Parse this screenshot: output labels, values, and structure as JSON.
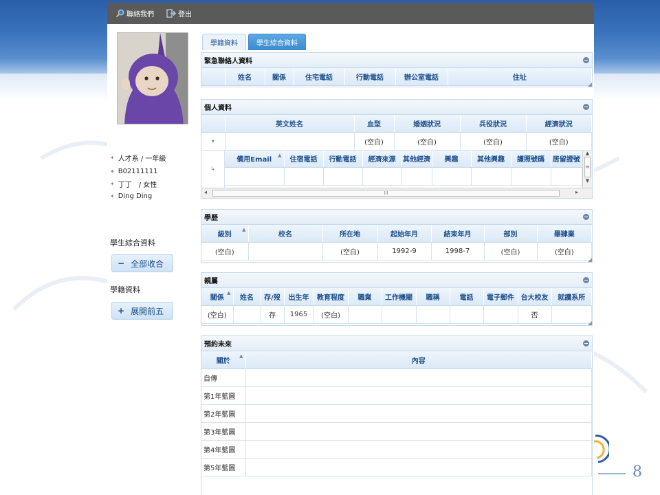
{
  "slide": {
    "page_number": "8"
  },
  "toolbar": {
    "items": [
      {
        "label": "聯絡我們",
        "icon": "search-icon"
      },
      {
        "label": "登出",
        "icon": "logout-icon"
      }
    ]
  },
  "profile": {
    "dept_year": "人才系 / 一年級",
    "student_id": "B02111111",
    "name_gender": "丁丁　/ 女性",
    "english_name": "Ding Ding"
  },
  "sidebar": {
    "summary_heading": "學生綜合資料",
    "collapse_all_label": "全部收合",
    "registry_heading": "學籍資料",
    "expand_top_five_label": "展開前五"
  },
  "tabs": [
    {
      "label": "學籍資料",
      "active": false
    },
    {
      "label": "學生綜合資料",
      "active": true
    }
  ],
  "emergency": {
    "title": "緊急聯絡人資料",
    "columns": [
      "姓名",
      "關係",
      "住宅電話",
      "行動電話",
      "辦公室電話",
      "住址"
    ]
  },
  "personal": {
    "title": "個人資料",
    "columns": [
      "英文姓名",
      "血型",
      "婚姻狀況",
      "兵役狀況",
      "經濟狀況"
    ],
    "row": [
      "",
      "(空白)",
      "(空白)",
      "(空白)",
      "(空白)"
    ],
    "sub_columns": [
      "備用Email",
      "住宿電話",
      "行動電話",
      "經濟來源",
      "其他經濟",
      "興趣",
      "其他興趣",
      "護照號碼",
      "居留證號"
    ],
    "scroll_thumb_glyph": "≡",
    "hscroll_glyph": "III"
  },
  "education": {
    "title": "學歷",
    "columns": [
      "級別",
      "校名",
      "所在地",
      "起始年月",
      "結束年月",
      "部別",
      "畢肄業"
    ],
    "rows": [
      [
        "(空白)",
        "",
        "(空白)",
        "1992-9",
        "1998-7",
        "(空白)",
        "(空白)"
      ]
    ]
  },
  "family": {
    "title": "親屬",
    "columns": [
      "關係",
      "姓名",
      "存/歿",
      "出生年",
      "教育程度",
      "職業",
      "工作機關",
      "職稱",
      "電話",
      "電子郵件",
      "台大校友",
      "就讀系所"
    ],
    "rows": [
      [
        "(空白)",
        "",
        "存",
        "1965",
        "(空白)",
        "",
        "",
        "",
        "",
        "",
        "否",
        ""
      ]
    ]
  },
  "future": {
    "title": "預約未來",
    "columns": [
      "關於",
      "內容"
    ],
    "rows": [
      "自傳",
      "第1年藍圖",
      "第2年藍圖",
      "第3年藍圖",
      "第4年藍圖",
      "第5年藍圖"
    ]
  },
  "colors": {
    "accent": "#3b8bd0",
    "header_text": "#1d4f8b",
    "topbar": "#5a5a5a",
    "slide_band": "#3a73bd"
  }
}
